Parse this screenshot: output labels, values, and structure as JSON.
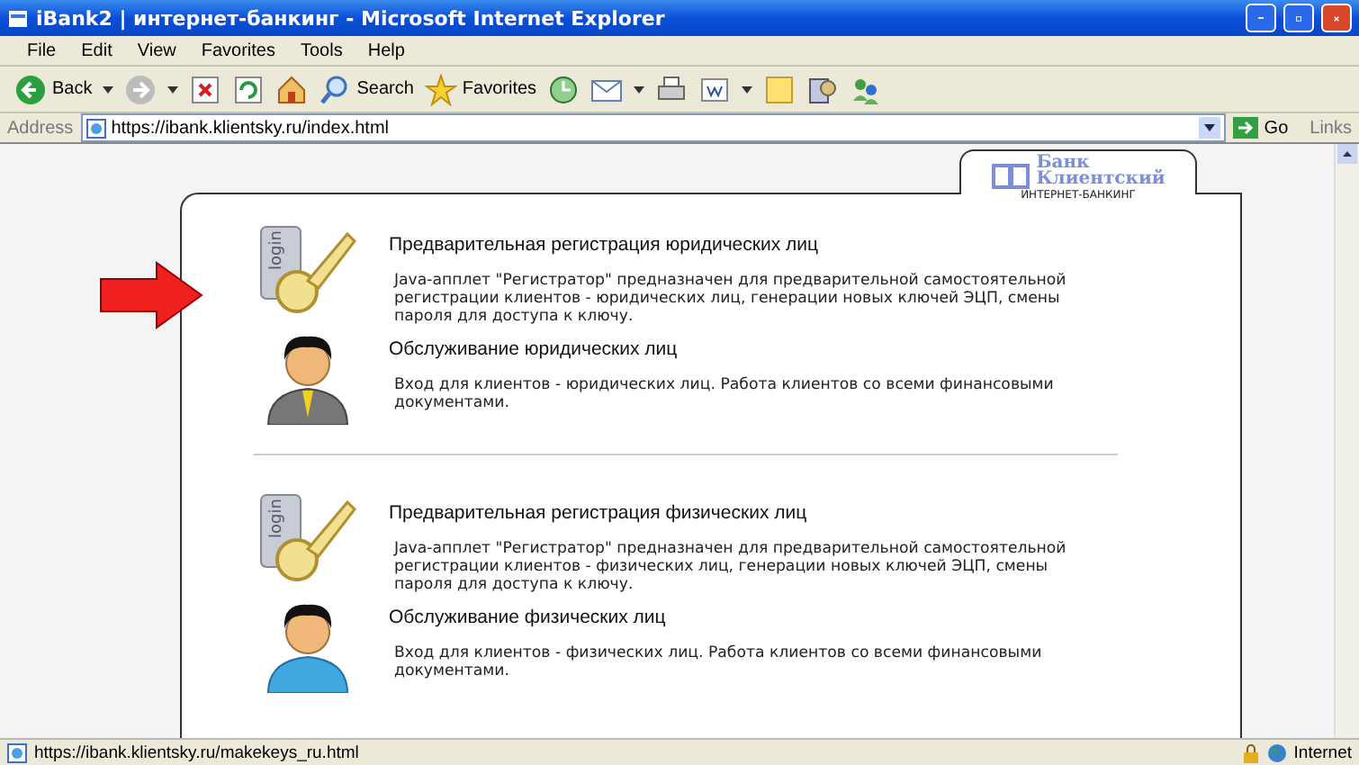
{
  "window": {
    "title": "iBank2 | интернет-банкинг - Microsoft Internet Explorer"
  },
  "menu": [
    "File",
    "Edit",
    "View",
    "Favorites",
    "Tools",
    "Help"
  ],
  "toolbar": [
    {
      "kind": "back",
      "label": "Back",
      "menu": true
    },
    {
      "kind": "forward",
      "menu": true
    },
    {
      "kind": "stop"
    },
    {
      "kind": "refresh"
    },
    {
      "kind": "home"
    },
    {
      "kind": "search",
      "label": "Search"
    },
    {
      "kind": "favorites",
      "label": "Favorites"
    },
    {
      "kind": "history"
    },
    {
      "kind": "mail",
      "menu": true
    },
    {
      "kind": "print"
    },
    {
      "kind": "edit",
      "menu": true
    },
    {
      "kind": "notes"
    },
    {
      "kind": "research"
    },
    {
      "kind": "messenger"
    }
  ],
  "address": {
    "label": "Address",
    "url": "https://ibank.klientsky.ru/index.html",
    "go": "Go",
    "links": "Links"
  },
  "logo": {
    "word1": "Банк",
    "word2": "Клиентский",
    "tagline": "ИНТЕРНЕТ-БАНКИНГ"
  },
  "groups": [
    [
      {
        "kind": "key",
        "icon_label": "login",
        "title": "Предварительная регистрация юридических лиц",
        "description": "Java-апплет \"Регистратор\" предназначен для предварительной самостоятельной регистрации клиентов - юридических лиц, генерации новых ключей ЭЦП, смены пароля для доступа к ключу."
      },
      {
        "kind": "suit",
        "title": "Обслуживание юридических лиц",
        "description": "Вход для клиентов - юридических лиц. Работа клиентов со всеми финансовыми документами."
      }
    ],
    [
      {
        "kind": "key",
        "icon_label": "login",
        "title": "Предварительная регистрация физических лиц",
        "description": "Java-апплет \"Регистратор\" предназначен для предварительной самостоятельной регистрации клиентов - физических лиц, генерации новых ключей ЭЦП, смены пароля для доступа к ключу."
      },
      {
        "kind": "casual",
        "title": "Обслуживание физических лиц",
        "description": "Вход для клиентов - физических лиц. Работа клиентов со всеми финансовыми документами."
      }
    ]
  ],
  "status": {
    "url": "https://ibank.klientsky.ru/makekeys_ru.html",
    "zone": "Internet"
  }
}
